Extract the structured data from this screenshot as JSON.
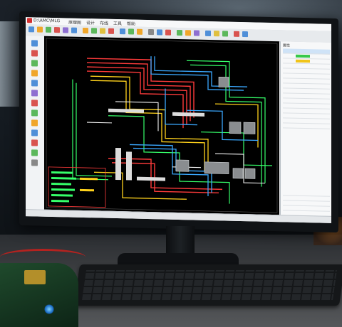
{
  "scene": {
    "title_fragments": [
      "D:\\AMC\\MLG",
      "原理图",
      "设计",
      "布线",
      "工具",
      "帮助"
    ],
    "panel_title": "属性",
    "status_text": "",
    "colors": {
      "trace_red": "#ff3b3b",
      "trace_yellow": "#ffd21c",
      "trace_green": "#36ff6a",
      "trace_blue": "#3aa8ff",
      "trace_white": "#f2f2f2",
      "canvas_bg": "#000000",
      "ui_bg": "#eef0f2"
    },
    "icons": [
      "toolbar-icon",
      "layer-icon",
      "wire-icon",
      "component-icon"
    ]
  }
}
